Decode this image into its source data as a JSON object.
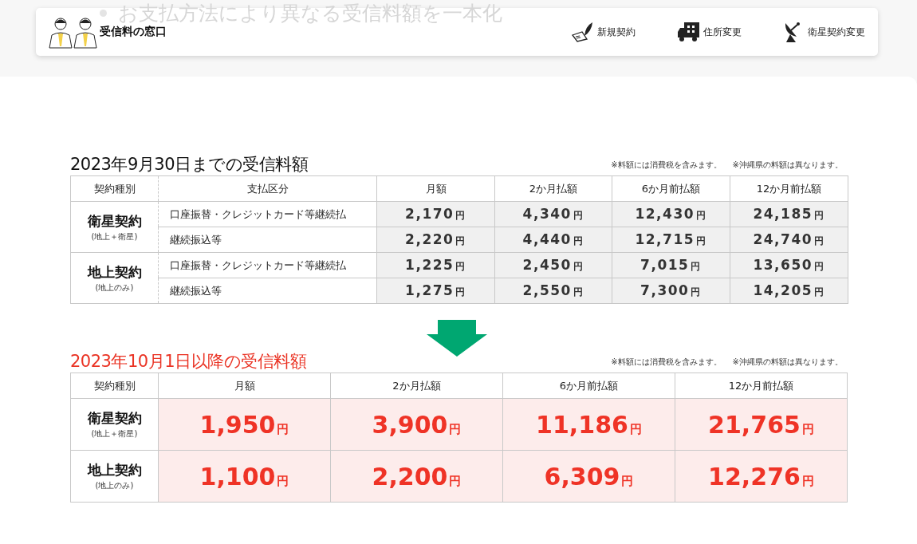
{
  "background_text": "お支払方法により異なる受信料額を一本化",
  "header": {
    "title": "受信料の窓口",
    "nav": [
      {
        "kind": "pen",
        "label": "新規契約"
      },
      {
        "kind": "truck",
        "label": "住所変更"
      },
      {
        "kind": "dish",
        "label": "衛星契約変更"
      }
    ]
  },
  "old_fees": {
    "title": "2023年9月30日までの受信料額",
    "notes": [
      "※料額には消費税を含みます。",
      "※沖縄県の料額は異なります。"
    ],
    "columns": [
      "契約種別",
      "支払区分",
      "月額",
      "2か月払額",
      "6か月前払額",
      "12か月前払額"
    ],
    "groups": [
      {
        "name": "衛星契約",
        "sub": "(地上＋衛星)",
        "rows": [
          {
            "method": "口座振替・クレジットカード等継続払",
            "prices": [
              {
                "amount": "2,170",
                "unit": "円"
              },
              {
                "amount": "4,340",
                "unit": "円"
              },
              {
                "amount": "12,430",
                "unit": "円"
              },
              {
                "amount": "24,185",
                "unit": "円"
              }
            ]
          },
          {
            "method": "継続振込等",
            "prices": [
              {
                "amount": "2,220",
                "unit": "円"
              },
              {
                "amount": "4,440",
                "unit": "円"
              },
              {
                "amount": "12,715",
                "unit": "円"
              },
              {
                "amount": "24,740",
                "unit": "円"
              }
            ]
          }
        ]
      },
      {
        "name": "地上契約",
        "sub": "(地上のみ)",
        "rows": [
          {
            "method": "口座振替・クレジットカード等継続払",
            "prices": [
              {
                "amount": "1,225",
                "unit": "円"
              },
              {
                "amount": "2,450",
                "unit": "円"
              },
              {
                "amount": "7,015",
                "unit": "円"
              },
              {
                "amount": "13,650",
                "unit": "円"
              }
            ]
          },
          {
            "method": "継続振込等",
            "prices": [
              {
                "amount": "1,275",
                "unit": "円"
              },
              {
                "amount": "2,550",
                "unit": "円"
              },
              {
                "amount": "7,300",
                "unit": "円"
              },
              {
                "amount": "14,205",
                "unit": "円"
              }
            ]
          }
        ]
      }
    ]
  },
  "new_fees": {
    "title": "2023年10月1日以降の受信料額",
    "notes": [
      "※料額には消費税を含みます。",
      "※沖縄県の料額は異なります。"
    ],
    "columns": [
      "契約種別",
      "月額",
      "2か月払額",
      "6か月前払額",
      "12か月前払額"
    ],
    "rows": [
      {
        "name": "衛星契約",
        "sub": "(地上＋衛星)",
        "prices": [
          {
            "amount": "1,950",
            "unit": "円"
          },
          {
            "amount": "3,900",
            "unit": "円"
          },
          {
            "amount": "11,186",
            "unit": "円"
          },
          {
            "amount": "21,765",
            "unit": "円"
          }
        ]
      },
      {
        "name": "地上契約",
        "sub": "(地上のみ)",
        "prices": [
          {
            "amount": "1,100",
            "unit": "円"
          },
          {
            "amount": "2,200",
            "unit": "円"
          },
          {
            "amount": "6,309",
            "unit": "円"
          },
          {
            "amount": "12,276",
            "unit": "円"
          }
        ]
      }
    ]
  }
}
